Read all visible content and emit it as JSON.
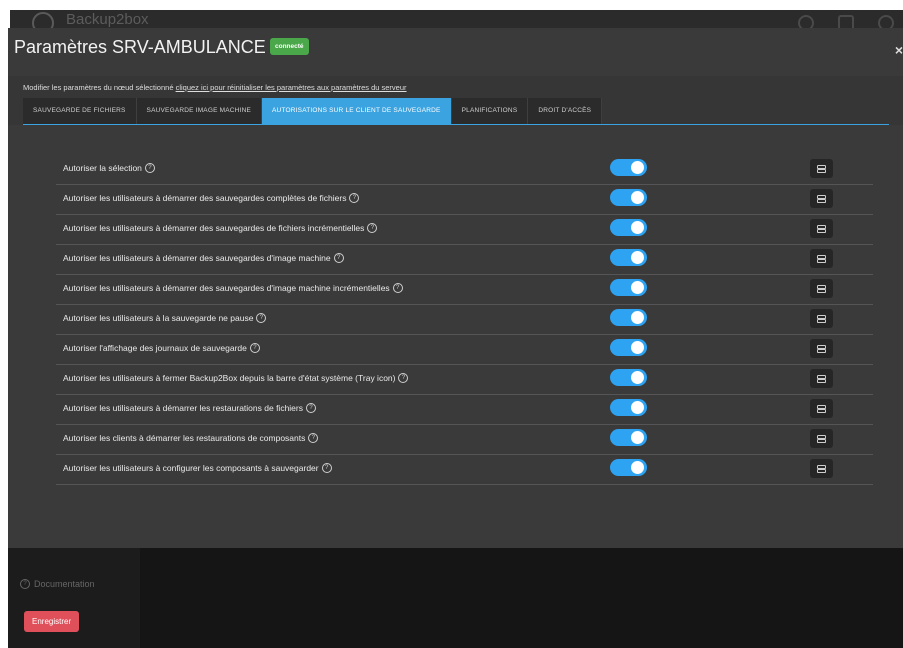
{
  "app": {
    "name": "Backup2box"
  },
  "modal": {
    "title": "Paramètres SRV-AMBULANCE",
    "status_badge": "connecté",
    "close_label": "×",
    "subtitle_text": "Modifier les paramètres du nœud sélectionné ",
    "subtitle_link": "cliquez ici pour réinitialiser les paramètres aux paramètres du serveur"
  },
  "tabs": [
    {
      "label": "SAUVEGARDE DE FICHIERS",
      "active": false
    },
    {
      "label": "SAUVEGARDE IMAGE MACHINE",
      "active": false
    },
    {
      "label": "AUTORISATIONS SUR LE CLIENT DE SAUVEGARDE",
      "active": true
    },
    {
      "label": "PLANIFICATIONS",
      "active": false
    },
    {
      "label": "DROIT D'ACCÈS",
      "active": false
    }
  ],
  "permissions": [
    {
      "label": "Autoriser la sélection",
      "enabled": true
    },
    {
      "label": "Autoriser les utilisateurs à démarrer des sauvegardes complètes de fichiers",
      "enabled": true
    },
    {
      "label": "Autoriser les utilisateurs à démarrer des sauvegardes de fichiers incrémentielles",
      "enabled": true
    },
    {
      "label": "Autoriser les utilisateurs à démarrer des sauvegardes d'image machine",
      "enabled": true
    },
    {
      "label": "Autoriser les utilisateurs à démarrer des sauvegardes d'image machine incrémentielles",
      "enabled": true
    },
    {
      "label": "Autoriser les utilisateurs à la sauvegarde ne pause",
      "enabled": true
    },
    {
      "label": "Autoriser l'affichage des journaux de sauvegarde",
      "enabled": true
    },
    {
      "label": "Autoriser les utilisateurs à fermer Backup2Box depuis la barre d'état système (Tray icon)",
      "enabled": true
    },
    {
      "label": "Autoriser les utilisateurs à démarrer les restaurations de fichiers",
      "enabled": true
    },
    {
      "label": "Autoriser les clients à démarrer les restaurations de composants",
      "enabled": true
    },
    {
      "label": "Autoriser les utilisateurs à configurer les composants à sauvegarder",
      "enabled": true
    }
  ],
  "save_button": "Enregistrer",
  "sidebar": {
    "documentation": "Documentation"
  },
  "colors": {
    "accent": "#3ba3e0",
    "toggle_on": "#2ea3f2",
    "save": "#e0505a",
    "badge": "#4aa84a"
  },
  "icons": {
    "help": "help-circle-icon",
    "server": "server-icon",
    "close": "close-icon"
  }
}
